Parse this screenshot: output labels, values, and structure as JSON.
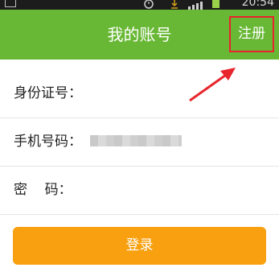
{
  "status_bar": {
    "time": "20:54",
    "icons": [
      "image-icon",
      "alarm-icon",
      "download-icon",
      "signal-icon",
      "battery-icon"
    ]
  },
  "header": {
    "title": "我的账号",
    "register_label": "注册",
    "background_color": "#68b835"
  },
  "form": {
    "id_label": "身份证号：",
    "phone_label": "手机号码：",
    "password_label": "密    码："
  },
  "actions": {
    "login_label": "登录",
    "login_color": "#f8a00f"
  },
  "annotation": {
    "highlight_color": "#e8242c"
  }
}
